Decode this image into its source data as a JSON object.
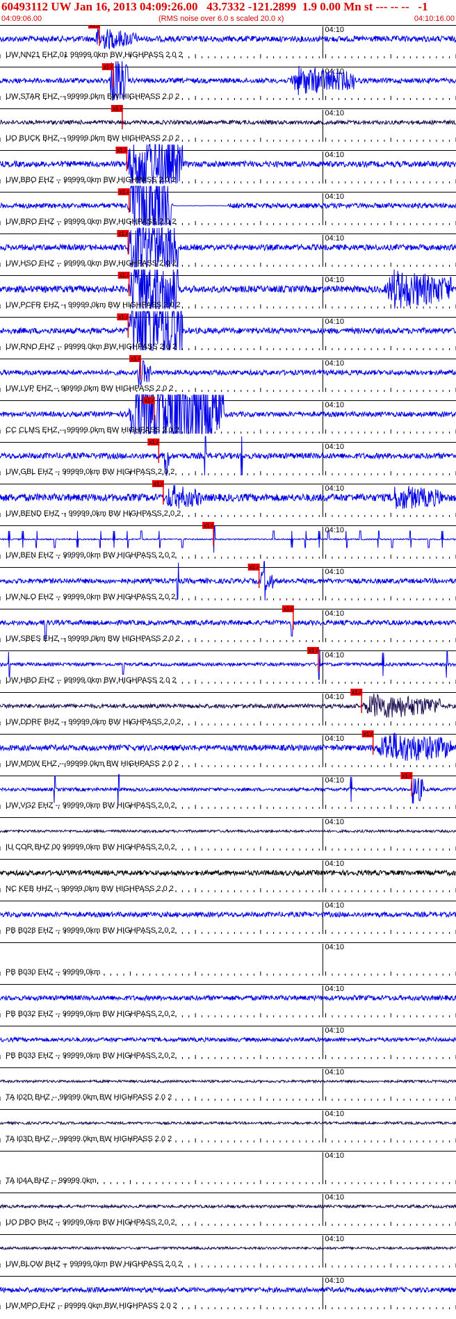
{
  "header": {
    "title": "60493112 UW Jan 16, 2013 04:09:26.00   43.7332 -121.2899  1.9 0.00 Mn st --- -- --   -1",
    "start_time": "04:09:06.00",
    "note": "(RMS noise over 6.0 s scaled 20.0 x)",
    "end_time": "04:10:16.00"
  },
  "colors": {
    "header": "#d80000",
    "trace_blue": "#0000e6",
    "trace_dark": "#1a0a50",
    "trace_black": "#000000",
    "pick": "#e60000"
  },
  "chart_data": {
    "type": "line",
    "x_range": [
      "04:09:06.00",
      "04:10:16.00"
    ],
    "tick_label": "04:10",
    "pick_label": "x1.4",
    "traces": [
      {
        "label": "UW NN21 EHZ 01 99999.0km BW  HIGHPASS  2.0  2",
        "color": "blue",
        "amp": 0.35,
        "pick": 0.215,
        "bursts": [
          [
            0.2,
            0.3,
            1.4
          ]
        ]
      },
      {
        "label": "UW STAR EHZ -- 99999.0km BW  HIGHPASS  2.0  2",
        "color": "blue",
        "amp": 0.3,
        "pick": 0.245,
        "bursts": [
          [
            0.24,
            0.28,
            3.5
          ],
          [
            0.63,
            0.78,
            1.8
          ]
        ]
      },
      {
        "label": "UO BUCK BHZ -- 99999.0km BW  HIGHPASS  2.0  2",
        "color": "dark",
        "amp": 0.25,
        "pick": 0.265,
        "bursts": []
      },
      {
        "label": "UW BBO EHZ -- 99999.0km BW  HIGHPASS  2.0  2",
        "color": "blue",
        "amp": 0.35,
        "pick": 0.275,
        "bursts": [
          [
            0.275,
            0.4,
            4.5
          ]
        ]
      },
      {
        "label": "UW BRO EHZ -- 99999.0km BW  HIGHPASS  2.0  2",
        "color": "blue",
        "amp": 0.3,
        "pick": 0.28,
        "bursts": [
          [
            0.28,
            0.375,
            7
          ]
        ],
        "flat": [
          0.38,
          0.5
        ]
      },
      {
        "label": "UW HSO EHZ -- 99999.0km BW  HIGHPASS  2.0  2",
        "color": "blue",
        "amp": 0.35,
        "pick": 0.278,
        "bursts": [
          [
            0.278,
            0.39,
            5
          ]
        ]
      },
      {
        "label": "UW PCFR EHZ -- 99999.0km BW  HIGHPASS  2.0  2",
        "color": "blue",
        "amp": 0.4,
        "pick": 0.28,
        "bursts": [
          [
            0.28,
            0.39,
            5
          ],
          [
            0.84,
            0.99,
            2.5
          ]
        ]
      },
      {
        "label": "UW RNO EHZ -- 99999.0km BW  HIGHPASS  2.0  2",
        "color": "blue",
        "amp": 0.35,
        "pick": 0.278,
        "bursts": [
          [
            0.278,
            0.4,
            6
          ]
        ]
      },
      {
        "label": "UW LVP EHZ -- 99999.0km BW  HIGHPASS  2.0  2",
        "color": "blue",
        "amp": 0.3,
        "pick": 0.305,
        "bursts": [
          [
            0.3,
            0.33,
            1.8
          ]
        ]
      },
      {
        "label": "CC CLMS EHZ -- 99999.0km BW  HIGHPASS  2.0  2",
        "color": "blue",
        "amp": 0.3,
        "pick": 0.335,
        "bursts": [
          [
            0.275,
            0.49,
            7
          ]
        ]
      },
      {
        "label": "UW GBL EHZ -- 99999.0km BW  HIGHPASS  2.0  2",
        "color": "blue",
        "amp": 0.35,
        "pick": 0.345,
        "bursts": [
          [
            0.36,
            0.37,
            2.5
          ]
        ],
        "spikes": [
          [
            0.365,
            3
          ],
          [
            0.45,
            3.5
          ],
          [
            0.53,
            3
          ]
        ]
      },
      {
        "label": "UW BEND EHZ -- 99999.0km BW  HIGHPASS  2.0  2",
        "color": "blue",
        "amp": 0.45,
        "pick": 0.355,
        "bursts": [
          [
            0.36,
            0.44,
            1.6
          ],
          [
            0.85,
            0.97,
            1.6
          ]
        ]
      },
      {
        "label": "UW BEN EHZ -- 99999.0km BW  HIGHPASS  2.0  2",
        "color": "blue",
        "amp": 0.08,
        "pick": 0.465,
        "bursts": [],
        "spikes": [
          [
            0.02,
            1
          ],
          [
            0.05,
            1
          ],
          [
            0.08,
            1
          ],
          [
            0.12,
            1
          ],
          [
            0.17,
            1
          ],
          [
            0.22,
            1
          ],
          [
            0.25,
            1
          ],
          [
            0.28,
            1
          ],
          [
            0.31,
            1
          ],
          [
            0.35,
            1
          ],
          [
            0.4,
            1
          ],
          [
            0.47,
            1.6
          ],
          [
            0.6,
            1
          ],
          [
            0.64,
            1
          ],
          [
            0.67,
            1
          ],
          [
            0.7,
            1
          ],
          [
            0.72,
            1
          ],
          [
            0.76,
            1
          ],
          [
            0.79,
            1
          ],
          [
            0.83,
            1
          ],
          [
            0.86,
            1
          ],
          [
            0.9,
            1
          ],
          [
            0.94,
            1
          ],
          [
            0.97,
            1
          ]
        ]
      },
      {
        "label": "UW NLO EHZ -- 99999.0km BW  HIGHPASS  2.0  2",
        "color": "blue",
        "amp": 0.3,
        "pick": 0.565,
        "bursts": [
          [
            0.57,
            0.6,
            1.5
          ]
        ],
        "spikes": [
          [
            0.39,
            2.2
          ],
          [
            0.58,
            2.5
          ]
        ]
      },
      {
        "label": "UW SBES EHZ -- 99999.0km BW  HIGHPASS  2.0  2",
        "color": "blue",
        "amp": 0.3,
        "pick": 0.64,
        "bursts": [],
        "spikes": [
          [
            0.1,
            2
          ],
          [
            0.64,
            1.6
          ]
        ]
      },
      {
        "label": "UW HBO EHZ -- 99999.0km BW  HIGHPASS  2.0  2",
        "color": "blue",
        "amp": 0.2,
        "pick": 0.695,
        "bursts": [],
        "spikes": [
          [
            0.02,
            1.5
          ],
          [
            0.27,
            1.2
          ],
          [
            0.7,
            1.8
          ],
          [
            0.84,
            1.4
          ],
          [
            0.98,
            1.6
          ]
        ]
      },
      {
        "label": "UW DDRF BHZ -- 99999.0km BW  HIGHPASS  2.0  2",
        "color": "dark",
        "amp": 0.25,
        "pick": 0.79,
        "bursts": [
          [
            0.79,
            0.97,
            1.6
          ]
        ]
      },
      {
        "label": "UW MDW EHZ -- 99999.0km BW  HIGHPASS  2.0  2",
        "color": "blue",
        "amp": 0.35,
        "pick": 0.815,
        "bursts": [
          [
            0.82,
            0.99,
            2
          ]
        ]
      },
      {
        "label": "UW VG2 EHZ -- 99999.0km BW  HIGHPASS  2.0  2",
        "color": "blue",
        "amp": 0.2,
        "pick": 0.9,
        "bursts": [
          [
            0.9,
            0.93,
            2
          ]
        ],
        "spikes": [
          [
            0.12,
            1.6
          ],
          [
            0.26,
            1.8
          ],
          [
            0.77,
            1.5
          ]
        ]
      },
      {
        "label": "IU COR BHZ 00 99999.0km BW  HIGHPASS  2.0  2",
        "color": "dark",
        "amp": 0.15,
        "bursts": []
      },
      {
        "label": "NC KEB HHZ -- 99999.0km BW  HIGHPASS  2.0  2",
        "color": "black",
        "amp": 0.3,
        "bursts": []
      },
      {
        "label": "PB B028 EHZ -- 99999.0km BW  HIGHPASS  2.0  2",
        "color": "blue",
        "amp": 0.3,
        "bursts": []
      },
      {
        "label": "PB B030 EHZ -- 99999.0km",
        "color": "none",
        "amp": 0,
        "bursts": []
      },
      {
        "label": "PB B032 EHZ -- 99999.0km BW  HIGHPASS  2.0  2",
        "color": "blue",
        "amp": 0.3,
        "bursts": []
      },
      {
        "label": "PB B033 EHZ -- 99999.0km BW  HIGHPASS  2.0  2",
        "color": "blue",
        "amp": 0.25,
        "bursts": []
      },
      {
        "label": "TA I02D BHZ -- 99999.0km BW  HIGHPASS  2.0  2",
        "color": "dark",
        "amp": 0.15,
        "bursts": []
      },
      {
        "label": "TA I03D BHZ -- 99999.0km BW  HIGHPASS  2.0  2",
        "color": "dark",
        "amp": 0.15,
        "bursts": []
      },
      {
        "label": "TA I04A BHZ -- 99999.0km",
        "color": "none",
        "amp": 0,
        "bursts": []
      },
      {
        "label": "UO DBO BHZ -- 99999.0km BW  HIGHPASS  2.0  2",
        "color": "dark",
        "amp": 0.18,
        "bursts": []
      },
      {
        "label": "UW BLOW BHZ -- 99999.0km BW  HIGHPASS  2.0  2",
        "color": "dark",
        "amp": 0.15,
        "bursts": []
      },
      {
        "label": "UW MPO EHZ -- 99999.0km BW  HIGHPASS  2.0  2",
        "color": "blue",
        "amp": 0.3,
        "bursts": []
      }
    ]
  }
}
